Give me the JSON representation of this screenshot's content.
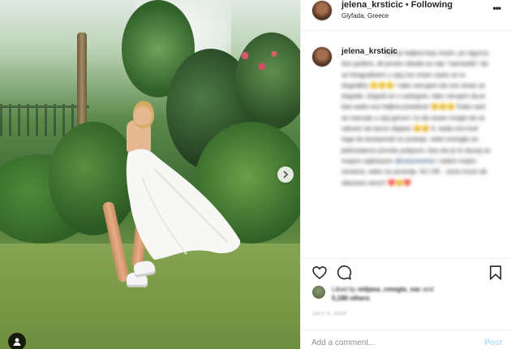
{
  "post": {
    "username": "jelena_krsticic",
    "separator": "•",
    "follow_label": "Following",
    "location": "Glyfada, Greece",
    "more_icon": "more-horizontal-icon"
  },
  "caption": {
    "username": "jelena_krsticic",
    "text_parts": [
      "Ovo je haljina koju imam, po sigurno dve godine, ali prosto nikada se nije \"namestilo\" da se fotografisem u njoj (ne znam zasto se to dogodilo) ",
      "🙁🙁🙁",
      " i tako venujem da ove stvari se dogode, dogodi se s razlogom, tako verujem da je bas sada ova haljina posebna! ",
      "😊😊😊",
      " Kako sam se osecala u njoj govori i to da nisam mogla da se oduzim da tacno objasni ",
      "😊😊",
      " A, kada ono kod toga da duzeprosti ne postoje, neke energije sa jednostavno privuku potpuno, kao sto je to slucaj sa mojom najdrazom ",
      "@onlyonemoi",
      " i nekim mojim zenama, nebo ne poverije. ALI OK - zena moze da obozava zenu!! ",
      "❤️😊❤️"
    ]
  },
  "likes": {
    "prefix": "Liked by",
    "first_user": "miljana_cmogla_vac",
    "middle": "and",
    "others": "5,186 others"
  },
  "post_date": "JULY 9, 2019",
  "comment": {
    "placeholder": "Add a comment...",
    "post_label": "Post"
  },
  "icons": {
    "like": "heart-outline-icon",
    "comment": "comment-bubble-icon",
    "save": "bookmark-icon",
    "next": "chevron-right-icon",
    "tag": "user-tag-icon"
  },
  "colors": {
    "text": "#262626",
    "muted": "#8e8e8e",
    "divider": "#efefef",
    "post_button": "#b2dffc",
    "mention": "#003569"
  }
}
